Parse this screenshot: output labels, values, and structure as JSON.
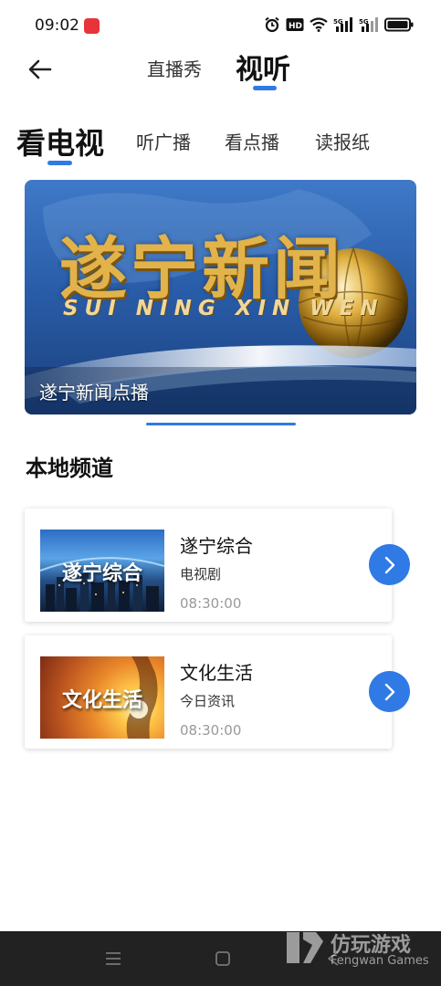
{
  "status_bar": {
    "time": "09:02",
    "app_icon": "red-app-icon",
    "icons": [
      "alarm-icon",
      "hd-icon",
      "wifi-icon",
      "signal-5g-icon",
      "signal-5g-icon",
      "battery-icon"
    ],
    "hd_label": "HD",
    "net_label": "5G"
  },
  "top_nav": {
    "back_icon": "arrow-left-icon",
    "tabs": [
      {
        "label": "直播秀",
        "active": false
      },
      {
        "label": "视听",
        "active": true
      }
    ]
  },
  "sub_tabs": [
    {
      "label": "看电视",
      "active": true
    },
    {
      "label": "听广播",
      "active": false
    },
    {
      "label": "看点播",
      "active": false
    },
    {
      "label": "读报纸",
      "active": false
    }
  ],
  "banner": {
    "logo_text": "遂宁新闻",
    "pinyin": "SUI NING XIN WEN",
    "caption": "遂宁新闻点播"
  },
  "section": {
    "title": "本地频道"
  },
  "channels": [
    {
      "thumb_label": "遂宁综合",
      "name": "遂宁综合",
      "type": "电视剧",
      "time": "08:30:00"
    },
    {
      "thumb_label": "文化生活",
      "name": "文化生活",
      "type": "今日资讯",
      "time": "08:30:00"
    }
  ],
  "nav_bar": {
    "icons": [
      "menu-icon",
      "home-icon",
      "back-icon"
    ]
  },
  "watermark": {
    "cn": "仿玩游戏",
    "en": "Fengwan Games"
  },
  "colors": {
    "accent": "#2f7ae5",
    "nav_bar": "#222222"
  }
}
